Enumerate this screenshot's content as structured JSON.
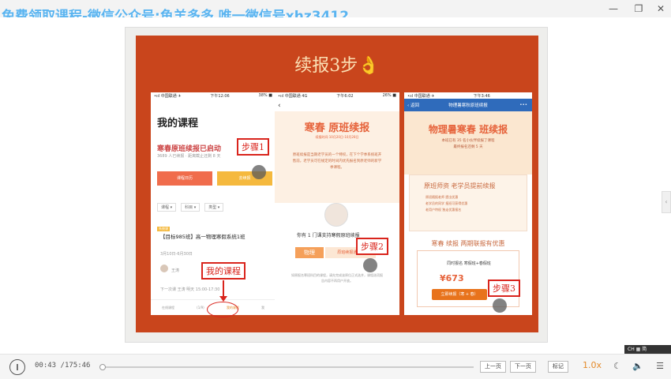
{
  "window": {
    "watermark": "免费领取课程-微信公众号:鱼羊多多 唯一微信号xhz3412",
    "controls": {
      "minimize": "—",
      "maximize": "❐",
      "close": "✕"
    }
  },
  "slide": {
    "title": "续报3步👌",
    "phone1": {
      "status_left": "•ııl 中国联通 ✈",
      "status_center": "下午12:06",
      "status_right": "38% ■",
      "title": "我的课程",
      "promo": "寒春原班续报已启动",
      "promo_sub": "3689 人已续报 · 距离截止还剩 8 天",
      "btn_left": "课程日历",
      "btn_right": "去续报",
      "filters": [
        "课程 ▾",
        "科目 ▾",
        "类型 ▾"
      ],
      "course_tag": "系统课",
      "course_title": "【目标985班】高一物理寒假系统1班",
      "course_date": "3月10日-6月30日",
      "teacher": "王涛",
      "next_lesson": "下一次课 王涛 明天 15:00-17:30",
      "tabs": [
        "在线课程",
        "(1/9)",
        "我的课程",
        "我"
      ]
    },
    "phone2": {
      "status_left": "•ııl 中国联通 4G",
      "status_center": "下午6:02",
      "status_right": "26% ■",
      "back": "‹",
      "hero_title": "寒春 原班续报",
      "hero_date": "续报时间 10月20日-10月28日",
      "hero_desc": "原班续报是当期老学员的一个特权，在下个学季系统班开售前，老学员可在规定的时间内优先报名到原老师的新学季课程。",
      "notice": "你有 1 门课支持寒假原班续报",
      "subject": "物理",
      "subject_link": "原班续报通道 ›",
      "footnote": "如原报名寒班科目的课程，请先完成该原位正式选并，课程选项报告内容不再用户开放。"
    },
    "phone3": {
      "status_left": "•ııl 中国联通 ✈",
      "status_center": "下午3:46",
      "nav_back": "‹ 返回",
      "nav_title": "物理暑寒秋原班续报",
      "nav_more": "•••",
      "title": "物理暑寒春 班续报",
      "sub": "本班已有 35 名小伙伴续报了课程\n最终报名还剩 5 天",
      "card1_title": "原班师资 老学员提前续报",
      "card1_items": [
        "原班随报老师 提出优惠",
        "老学员的同学 报班可获得优惠",
        "老用户特权 独走优惠报名"
      ],
      "card2_title": "寒春 续报 两期联报有优惠",
      "card2_line": "同时报名 寒假班+春假班",
      "price": "¥673",
      "buy": "立即续报（寒 + 春）"
    },
    "steps": {
      "step1": "步骤1",
      "step2": "步骤2",
      "step3": "步骤3",
      "my_course": "我的课程"
    }
  },
  "player": {
    "play_icon": "‖",
    "time_current": "00:43",
    "time_total": "175:46",
    "time_sep": " /",
    "progress": 0.004,
    "prev": "上一页",
    "next": "下一页",
    "note": "标记",
    "speed": "1.0x",
    "side_handle": "‹",
    "ime": "CH ▦ 简"
  },
  "colors": {
    "board": "#c9451c",
    "accent": "#e48a2a",
    "step": "#d9241c"
  }
}
